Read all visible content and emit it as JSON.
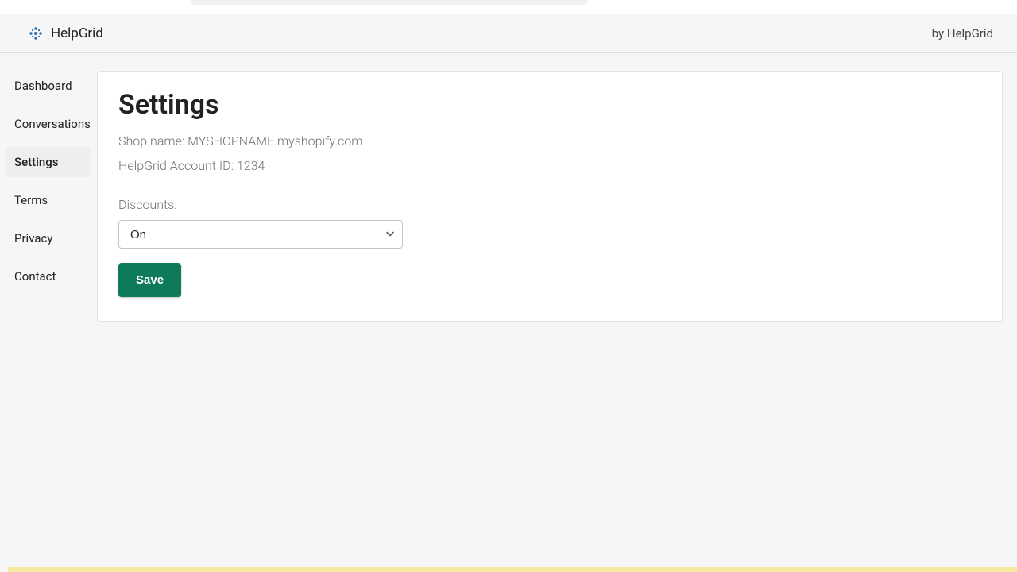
{
  "header": {
    "brand": "HelpGrid",
    "by": "by HelpGrid"
  },
  "sidebar": {
    "items": [
      {
        "label": "Dashboard",
        "active": false
      },
      {
        "label": "Conversations",
        "active": false
      },
      {
        "label": "Settings",
        "active": true
      },
      {
        "label": "Terms",
        "active": false
      },
      {
        "label": "Privacy",
        "active": false
      },
      {
        "label": "Contact",
        "active": false
      }
    ]
  },
  "main": {
    "title": "Settings",
    "shop_line": "Shop name: MYSHOPNAME.myshopify.com",
    "account_line": "HelpGrid Account ID: 1234",
    "discounts_label": "Discounts:",
    "discounts_value": "On",
    "save_label": "Save"
  },
  "colors": {
    "button_bg": "#0f7a5a"
  }
}
